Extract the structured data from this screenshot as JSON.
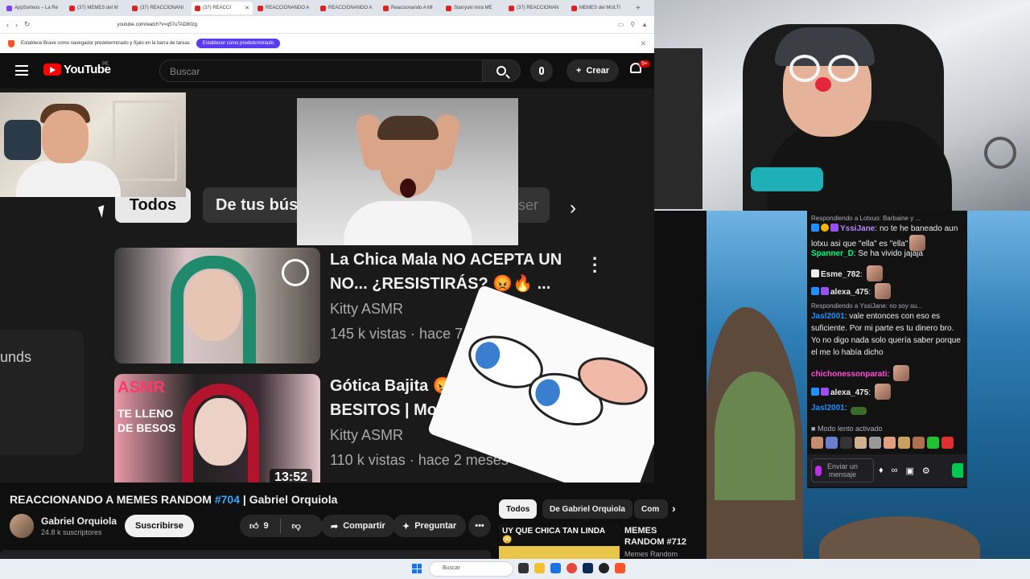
{
  "browser": {
    "tabs": [
      {
        "label": "AppSorteos – La Re",
        "active": false
      },
      {
        "label": "(37) MEMES del M",
        "active": false
      },
      {
        "label": "(37) REACCIONANI",
        "active": false
      },
      {
        "label": "(37) REACCI",
        "active": true
      },
      {
        "label": "REACCIONANDO A",
        "active": false
      },
      {
        "label": "REACCIONANDO A",
        "active": false
      },
      {
        "label": "Reaccionando A MI",
        "active": false
      },
      {
        "label": "Starryuki mira ME",
        "active": false
      },
      {
        "label": "(37) REACCIONAN",
        "active": false
      },
      {
        "label": "MEMES del MULTI",
        "active": false
      }
    ],
    "new_tab": "+",
    "url": "youtube.com/watch?v=q57uTAD80zg",
    "infobar_text": "Establece Brave como navegador predeterminado y fíjalo en la barra de tareas",
    "infobar_button": "Establecer como predeterminado",
    "close_glyph": "✕"
  },
  "youtube": {
    "logo_text": "YouTube",
    "country_code": "PE",
    "search_placeholder": "Buscar",
    "create_label": "Crear",
    "notifications_badge": "9+",
    "video_overlay": {
      "chip_all": "Todos",
      "chip_search": "De tus bús",
      "chip_cut": "ser",
      "sidebar_fragment": "unds",
      "recommendations": [
        {
          "title_line1": "La Chica Mala NO ACEPTA UN",
          "title_line2": "NO... ¿RESISTIRÁS? 😡🔥 ...",
          "channel": "Kitty ASMR",
          "meta": "145 k vistas · hace 7 m"
        },
        {
          "title_line1": "Gótica Bajita 😡",
          "title_line2": "BESITOS | Mout",
          "channel": "Kitty ASMR",
          "meta": "110 k vistas · hace 2 meses",
          "duration": "13:52",
          "thumb_tag": "ASMR",
          "thumb_sub": "TE LLENO DE BESOS"
        }
      ]
    },
    "video_title_main": "REACCIONANDO A MEMES RANDOM ",
    "video_title_tag": "#704",
    "video_title_tail": " | Gabriel Orquiola",
    "channel_name": "Gabriel Orquiola",
    "channel_subs": "24.8 k suscriptores",
    "subscribe_label": "Suscribirse",
    "like_count": "9",
    "share_label": "Compartir",
    "ask_label": "Preguntar",
    "more_label": "•••",
    "side_chips": [
      "Todos",
      "De Gabriel Orquiola",
      "Com"
    ],
    "side_video": {
      "thumb_text": "UY QUE CHICA TAN LINDA 😳",
      "title": "MEMES RANDOM #712",
      "channel": "Memes Random"
    }
  },
  "chat": {
    "messages": [
      {
        "reply": "Respondiendo a Lotxuo: Barbaine y ...",
        "user": "YssiJane",
        "user_color": "#b985ff",
        "text": "no te he baneado aun lotxu asi que \"ella\" es \"ella\""
      },
      {
        "user": "Spanner_D",
        "user_color": "#00ff7f",
        "text": "Se ha vivido jajaja"
      },
      {
        "user": "Esme_782",
        "user_color": "#ffffff",
        "text": ""
      },
      {
        "user": "alexa_475",
        "user_color": "#ffffff",
        "text": ""
      },
      {
        "reply": "Respondiendo a YssiJane: no soy su...",
        "user": "Jasl2001",
        "user_color": "#1e90ff",
        "text": "vale entonces con eso es suficiente. Por mi parte es tu dinero bro. Yo no digo nada solo quería saber porque el me lo había dicho"
      },
      {
        "user": "chichonessonparati",
        "user_color": "#ff4fd8",
        "text": ""
      },
      {
        "user": "alexa_475",
        "user_color": "#ffffff",
        "text": ""
      },
      {
        "user": "Jasl2001",
        "user_color": "#1e90ff",
        "text": ""
      }
    ],
    "slow_mode": "Modo lento activado",
    "input_placeholder": "Enviar un mensaje",
    "infinity": "∞"
  },
  "taskbar": {
    "search_placeholder": "Buscar"
  }
}
